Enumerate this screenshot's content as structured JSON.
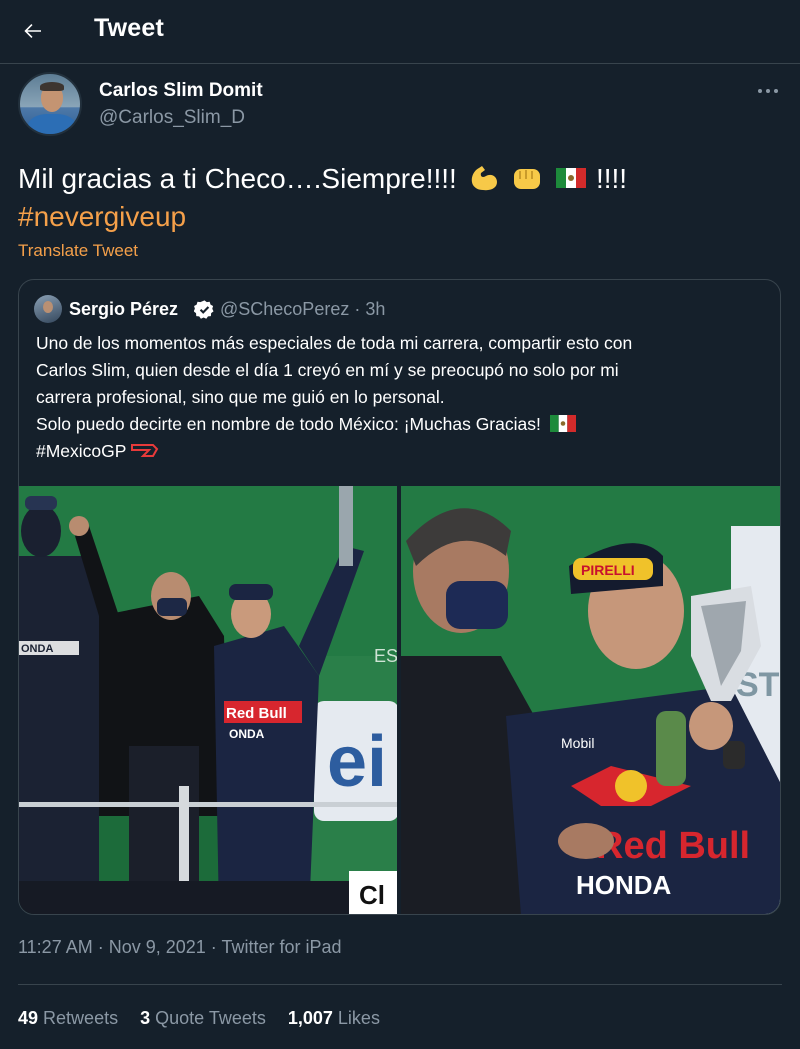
{
  "header": {
    "title": "Tweet",
    "back_icon": "arrow-left-icon"
  },
  "author": {
    "display_name": "Carlos Slim Domit",
    "handle": "@Carlos_Slim_D"
  },
  "tweet": {
    "text_main": "Mil gracias a ti Checo….Siempre!!!!",
    "emojis": [
      "flexed-biceps-emoji",
      "oncoming-fist-emoji",
      "mexico-flag-emoji"
    ],
    "text_after_emojis": "!!!!",
    "hashtag": "#nevergiveup",
    "translate_label": "Translate Tweet"
  },
  "quoted_tweet": {
    "display_name": "Sergio Pérez",
    "handle_time": "@SChecoPerez · 3h",
    "lines": [
      "Uno de los momentos más especiales de toda mi carrera, compartir esto con",
      "Carlos Slim, quien desde el día 1 creyó en mí y se preocupó no solo por mi",
      "carrera profesional, sino que me guió en lo personal.",
      "Solo puedo decirte en nombre de todo México: ¡Muchas Gracias!"
    ],
    "hashtag": "#MexicoGP",
    "photos": [
      {
        "content": "Podium celebration photo",
        "overlay_text": [
          "ONDA",
          "Red Bull",
          "ONDA",
          "ei",
          "ES",
          "Cl"
        ]
      },
      {
        "content": "Trophy close-up photo",
        "overlay_text": [
          "PIRELLI",
          "Red Bull",
          "HONDA",
          "Mobil",
          "ST"
        ]
      }
    ]
  },
  "meta": {
    "timestamp": "11:27 AM · Nov 9, 2021 · Twitter for iPad"
  },
  "stats": {
    "retweets_count": "49",
    "retweets_label": "Retweets",
    "quotes_count": "3",
    "quotes_label": "Quote Tweets",
    "likes_count": "1,007",
    "likes_label": "Likes"
  },
  "colors": {
    "background": "#15202b",
    "accent": "#f5a04a",
    "secondary_text": "#8b98a5",
    "border": "#38444d"
  }
}
